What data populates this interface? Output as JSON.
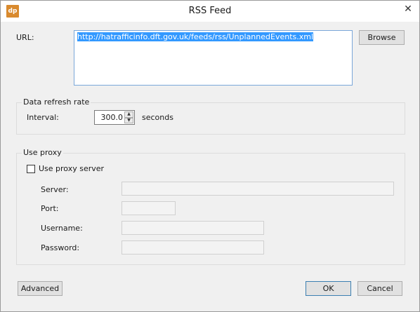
{
  "window": {
    "title": "RSS Feed",
    "app_icon_text": "dp",
    "close_symbol": "✕"
  },
  "url": {
    "label": "URL:",
    "value": "http://hatrafficinfo.dft.gov.uk/feeds/rss/UnplannedEvents.xml",
    "browse_label": "Browse"
  },
  "refresh": {
    "group_title": "Data refresh rate",
    "interval_label": "Interval:",
    "interval_value": "300.0",
    "unit": "seconds"
  },
  "proxy": {
    "group_title": "Use proxy",
    "checkbox_label": "Use proxy server",
    "checked": false,
    "server_label": "Server:",
    "port_label": "Port:",
    "username_label": "Username:",
    "password_label": "Password:"
  },
  "footer": {
    "advanced_label": "Advanced",
    "ok_label": "OK",
    "cancel_label": "Cancel"
  },
  "colors": {
    "selection": "#3399ff",
    "app_icon": "#d98a2e",
    "focus_border": "#7aa7d9"
  }
}
